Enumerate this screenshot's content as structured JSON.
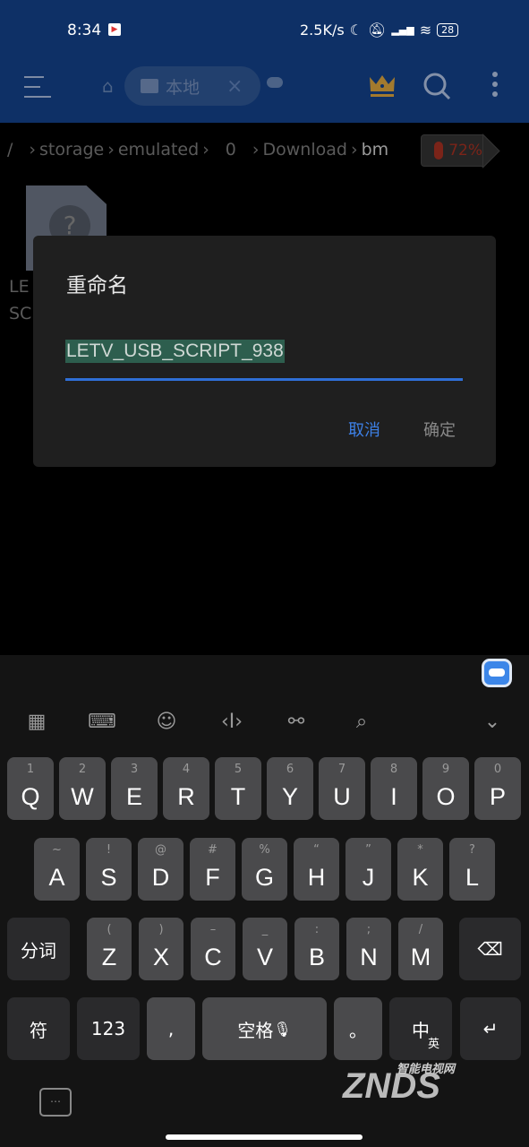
{
  "status": {
    "time": "8:34",
    "speed": "2.5K/s",
    "battery": "28",
    "signal": "HD"
  },
  "header": {
    "tab_label": "本地",
    "tab_close": "×"
  },
  "breadcrumb": {
    "items": [
      "/",
      "storage",
      "emulated",
      "0",
      "Download",
      "bm"
    ],
    "storage_percent": "72%"
  },
  "file": {
    "name": "LETV_USB_SCRIPT_938",
    "visible_name": "LE SC"
  },
  "dialog": {
    "title": "重命名",
    "input_value": "LETV_USB_SCRIPT_938",
    "cancel": "取消",
    "ok": "确定"
  },
  "colors": {
    "header_bg": "#0e3066",
    "accent": "#3d80e6",
    "selection": "#2d5e4e",
    "storage_warning": "#7b2419"
  },
  "keyboard": {
    "toolbar": [
      "grid-icon",
      "keyboard-layout-icon",
      "emoji-icon",
      "cursor-icon",
      "link-icon",
      "search-icon",
      "collapse-icon"
    ],
    "row1": [
      [
        "Q",
        "1"
      ],
      [
        "W",
        "2"
      ],
      [
        "E",
        "3"
      ],
      [
        "R",
        "4"
      ],
      [
        "T",
        "5"
      ],
      [
        "Y",
        "6"
      ],
      [
        "U",
        "7"
      ],
      [
        "I",
        "8"
      ],
      [
        "O",
        "9"
      ],
      [
        "P",
        "0"
      ]
    ],
    "row2": [
      [
        "A",
        "~"
      ],
      [
        "S",
        "!"
      ],
      [
        "D",
        "@"
      ],
      [
        "F",
        "#"
      ],
      [
        "G",
        "%"
      ],
      [
        "H",
        "“"
      ],
      [
        "J",
        "”"
      ],
      [
        "K",
        "*"
      ],
      [
        "L",
        "?"
      ]
    ],
    "row3": [
      [
        "Z",
        "("
      ],
      [
        "X",
        ")"
      ],
      [
        "C",
        "–"
      ],
      [
        "V",
        "_"
      ],
      [
        "B",
        ":"
      ],
      [
        "N",
        ";"
      ],
      [
        "M",
        "/"
      ]
    ],
    "segment": "分词",
    "backspace": "⌫",
    "symbols": "符",
    "numbers": "123",
    "comma": ",",
    "space": "空格",
    "period": "。",
    "lang_zh": "中",
    "lang_en": "英",
    "enter": "↵"
  },
  "watermark": {
    "text": "ZNDS",
    "sub": "智能电视网",
    ".com": ".com"
  }
}
